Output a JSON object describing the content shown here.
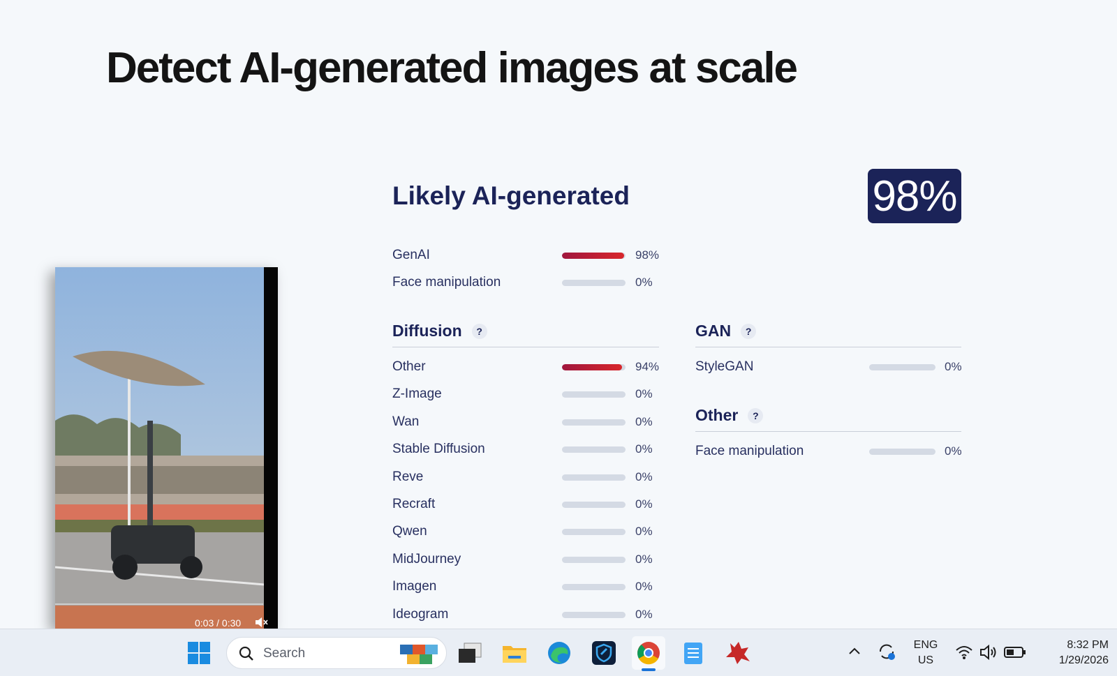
{
  "hero": {
    "title": "Detect AI-generated images at scale"
  },
  "video": {
    "time": "0:03 / 0:30"
  },
  "result": {
    "verdict": "Likely AI-generated",
    "score": "98%",
    "summary": [
      {
        "label": "GenAI",
        "value": 98,
        "pct": "98%"
      },
      {
        "label": "Face manipulation",
        "value": 0,
        "pct": "0%"
      }
    ]
  },
  "diffusion": {
    "title": "Diffusion",
    "help": "?",
    "items": [
      {
        "label": "Other",
        "value": 94,
        "pct": "94%"
      },
      {
        "label": "Z-Image",
        "value": 0,
        "pct": "0%"
      },
      {
        "label": "Wan",
        "value": 0,
        "pct": "0%"
      },
      {
        "label": "Stable Diffusion",
        "value": 0,
        "pct": "0%"
      },
      {
        "label": "Reve",
        "value": 0,
        "pct": "0%"
      },
      {
        "label": "Recraft",
        "value": 0,
        "pct": "0%"
      },
      {
        "label": "Qwen",
        "value": 0,
        "pct": "0%"
      },
      {
        "label": "MidJourney",
        "value": 0,
        "pct": "0%"
      },
      {
        "label": "Imagen",
        "value": 0,
        "pct": "0%"
      },
      {
        "label": "Ideogram",
        "value": 0,
        "pct": "0%"
      }
    ]
  },
  "gan": {
    "title": "GAN",
    "help": "?",
    "items": [
      {
        "label": "StyleGAN",
        "value": 0,
        "pct": "0%"
      }
    ]
  },
  "other": {
    "title": "Other",
    "help": "?",
    "items": [
      {
        "label": "Face manipulation",
        "value": 0,
        "pct": "0%"
      }
    ]
  },
  "taskbar": {
    "search_placeholder": "Search",
    "lang_line1": "ENG",
    "lang_line2": "US",
    "time": "8:32 PM",
    "date": "1/29/2026"
  },
  "colors": {
    "accent": "#1b2358",
    "bar_fill": "#d8262b",
    "bar_track": "#d4dae4"
  }
}
